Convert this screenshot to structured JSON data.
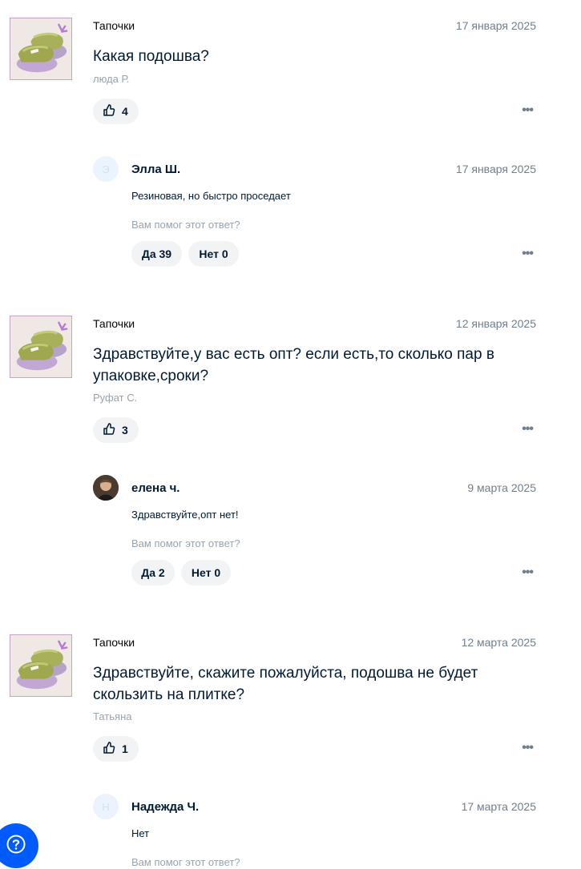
{
  "questions": [
    {
      "product": "Тапочки",
      "date": "17 января 2025",
      "text": "Какая подошва?",
      "author": "люда Р.",
      "likes": "4",
      "answer": {
        "avatar_letter": "Э",
        "name": "Элла Ш.",
        "date": "17 января 2025",
        "text": "Резиновая, но быстро проседает",
        "helpful_label": "Вам помог этот ответ?",
        "yes_label": "Да 39",
        "no_label": "Нет 0"
      }
    },
    {
      "product": "Тапочки",
      "date": "12 января 2025",
      "text": "Здравствуйте,у вас есть опт? если есть,то сколько пар в упаковке,сроки?",
      "author": "Руфат С.",
      "likes": "3",
      "answer": {
        "avatar_letter": "",
        "name": "елена ч.",
        "date": "9 марта 2025",
        "text": "Здравствуйте,опт нет!",
        "helpful_label": "Вам помог этот ответ?",
        "yes_label": "Да 2",
        "no_label": "Нет 0"
      }
    },
    {
      "product": "Тапочки",
      "date": "12 марта 2025",
      "text": "Здравствуйте, скажите пожалуйста, подошва не будет скользить на плитке?",
      "author": "Татьяна",
      "likes": "1",
      "answer": {
        "avatar_letter": "Н",
        "name": "Надежда Ч.",
        "date": "17 марта 2025",
        "text": "Нет",
        "helpful_label": "Вам помог этот ответ?"
      }
    }
  ],
  "icons": {
    "like": "thumbs-up-icon",
    "more": "more-dots-icon",
    "help": "question-icon"
  },
  "colors": {
    "accent": "#005bff",
    "chip_bg": "#f2f3f5",
    "muted_text": "#99a3ae"
  }
}
